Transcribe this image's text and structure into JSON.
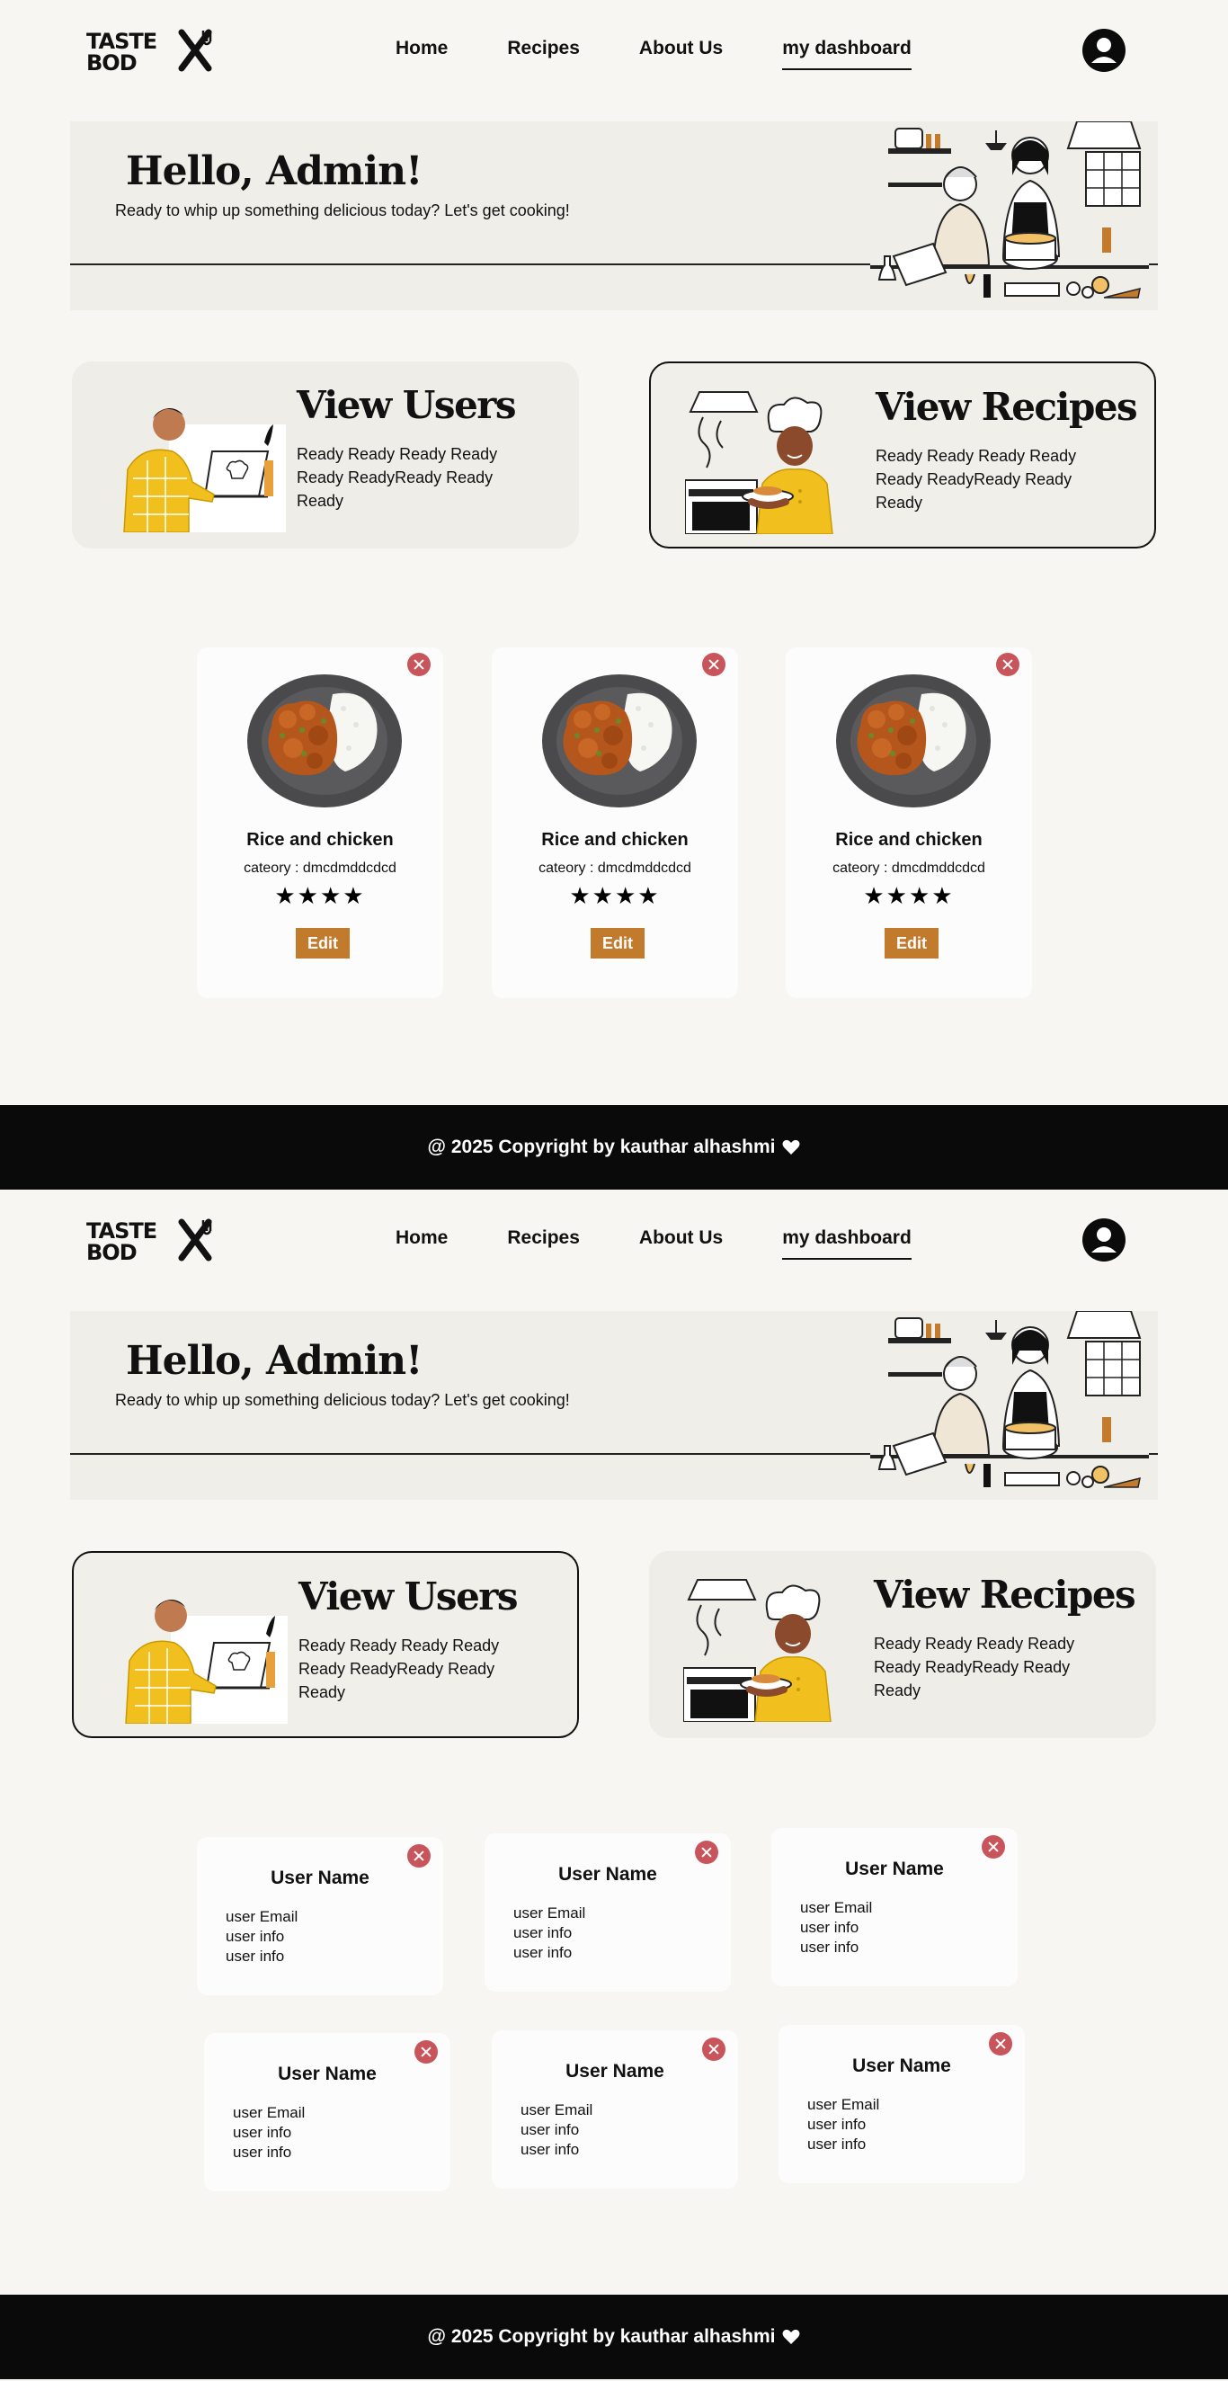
{
  "brand": {
    "logo_line1": "TASTE",
    "logo_line2": "BOD"
  },
  "colors": {
    "background": "#f8f6f2",
    "panel": "#efede8",
    "accent_orange": "#c27a2c",
    "close_red": "#c9555c",
    "footer": "#0a0a0a"
  },
  "nav": {
    "links": [
      {
        "label": "Home"
      },
      {
        "label": "Recipes"
      },
      {
        "label": "About Us"
      },
      {
        "label": "my dashboard",
        "active": true
      }
    ],
    "profile_icon": "user-circle-icon"
  },
  "hero": {
    "title": "Hello, Admin!",
    "subtitle": "Ready to whip up something delicious today? Let's get cooking!"
  },
  "features": {
    "users": {
      "title": "View Users",
      "desc": "Ready Ready Ready Ready Ready ReadyReady Ready Ready"
    },
    "recipes": {
      "title": "View Recipes",
      "desc": "Ready Ready Ready Ready Ready ReadyReady Ready Ready"
    }
  },
  "recipes": [
    {
      "name": "Rice and chicken",
      "category": "cateory : dmcdmddcdcd",
      "rating_stars": "★★★★",
      "rating": 4,
      "edit_label": "Edit"
    },
    {
      "name": "Rice and chicken",
      "category": "cateory : dmcdmddcdcd",
      "rating_stars": "★★★★",
      "rating": 4,
      "edit_label": "Edit"
    },
    {
      "name": "Rice and chicken",
      "category": "cateory : dmcdmddcdcd",
      "rating_stars": "★★★★",
      "rating": 4,
      "edit_label": "Edit"
    }
  ],
  "users": [
    {
      "name": "User Name",
      "email": "user Email",
      "info1": "user info",
      "info2": "user info"
    },
    {
      "name": "User Name",
      "email": "user Email",
      "info1": "user info",
      "info2": "user info"
    },
    {
      "name": "User Name",
      "email": "user Email",
      "info1": "user info",
      "info2": "user info"
    },
    {
      "name": "User Name",
      "email": "user Email",
      "info1": "user info",
      "info2": "user info"
    },
    {
      "name": "User Name",
      "email": "user Email",
      "info1": "user info",
      "info2": "user info"
    },
    {
      "name": "User Name",
      "email": "user Email",
      "info1": "user info",
      "info2": "user info"
    }
  ],
  "footer": {
    "text": "@ 2025 Copyright by kauthar alhashmi"
  }
}
